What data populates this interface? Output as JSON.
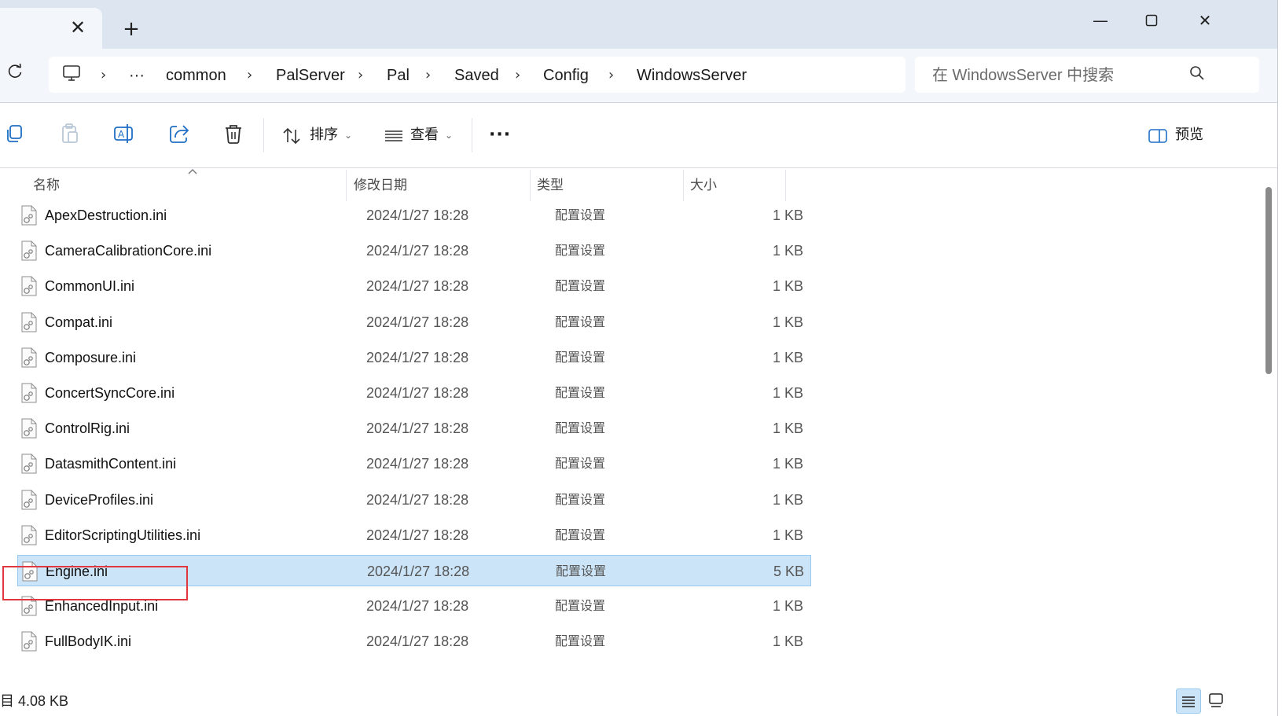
{
  "titlebar": {
    "tab_close": "✕",
    "new_tab": "+",
    "minimize": "—",
    "maximize": "☐",
    "close": "✕"
  },
  "address": {
    "more": "···",
    "crumbs": [
      "common",
      "PalServer",
      "Pal",
      "Saved",
      "Config",
      "WindowsServer"
    ],
    "search_placeholder": "在 WindowsServer 中搜索"
  },
  "toolbar": {
    "sort_label": "排序",
    "view_label": "查看",
    "more_label": "···",
    "preview_label": "预览"
  },
  "columns": {
    "name": "名称",
    "modified": "修改日期",
    "type": "类型",
    "size": "大小"
  },
  "files": [
    {
      "name": "ApexDestruction.ini",
      "modified": "2024/1/27 18:28",
      "type": "配置设置",
      "size": "1 KB"
    },
    {
      "name": "CameraCalibrationCore.ini",
      "modified": "2024/1/27 18:28",
      "type": "配置设置",
      "size": "1 KB"
    },
    {
      "name": "CommonUI.ini",
      "modified": "2024/1/27 18:28",
      "type": "配置设置",
      "size": "1 KB"
    },
    {
      "name": "Compat.ini",
      "modified": "2024/1/27 18:28",
      "type": "配置设置",
      "size": "1 KB"
    },
    {
      "name": "Composure.ini",
      "modified": "2024/1/27 18:28",
      "type": "配置设置",
      "size": "1 KB"
    },
    {
      "name": "ConcertSyncCore.ini",
      "modified": "2024/1/27 18:28",
      "type": "配置设置",
      "size": "1 KB"
    },
    {
      "name": "ControlRig.ini",
      "modified": "2024/1/27 18:28",
      "type": "配置设置",
      "size": "1 KB"
    },
    {
      "name": "DatasmithContent.ini",
      "modified": "2024/1/27 18:28",
      "type": "配置设置",
      "size": "1 KB"
    },
    {
      "name": "DeviceProfiles.ini",
      "modified": "2024/1/27 18:28",
      "type": "配置设置",
      "size": "1 KB"
    },
    {
      "name": "EditorScriptingUtilities.ini",
      "modified": "2024/1/27 18:28",
      "type": "配置设置",
      "size": "1 KB"
    },
    {
      "name": "Engine.ini",
      "modified": "2024/1/27 18:28",
      "type": "配置设置",
      "size": "5 KB",
      "selected": true
    },
    {
      "name": "EnhancedInput.ini",
      "modified": "2024/1/27 18:28",
      "type": "配置设置",
      "size": "1 KB"
    },
    {
      "name": "FullBodyIK.ini",
      "modified": "2024/1/27 18:28",
      "type": "配置设置",
      "size": "1 KB"
    }
  ],
  "status": {
    "text": "目 4.08 KB"
  },
  "icons": {
    "refresh": "refresh-icon",
    "this_pc": "monitor-icon",
    "search": "search-icon",
    "copy": "copy-icon",
    "paste": "paste-icon",
    "rename": "rename-icon",
    "share": "share-icon",
    "delete": "trash-icon",
    "sort": "sort-icon",
    "view": "view-icon",
    "preview": "preview-pane-icon",
    "file": "ini-file-icon"
  },
  "colors": {
    "titlebar": "#dde6f0",
    "selection": "#cce4f7",
    "highlight_box": "#e0383e"
  }
}
